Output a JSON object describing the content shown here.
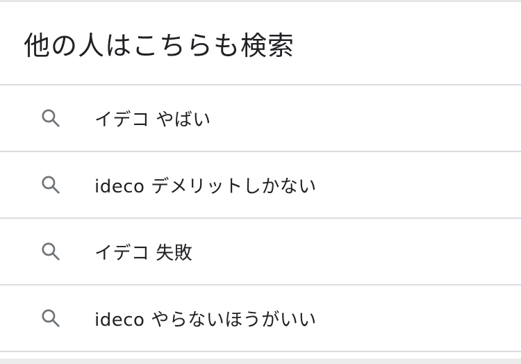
{
  "section": {
    "title": "他の人はこちらも検索"
  },
  "suggestions": [
    {
      "text": "イデコ やばい",
      "icon": "search-icon"
    },
    {
      "text": "ideco デメリットしかない",
      "icon": "search-icon"
    },
    {
      "text": "イデコ 失敗",
      "icon": "search-icon"
    },
    {
      "text": "ideco やらないほうがいい",
      "icon": "search-icon"
    }
  ],
  "colors": {
    "text": "#202124",
    "icon": "#70757a",
    "divider": "#dadce0"
  }
}
